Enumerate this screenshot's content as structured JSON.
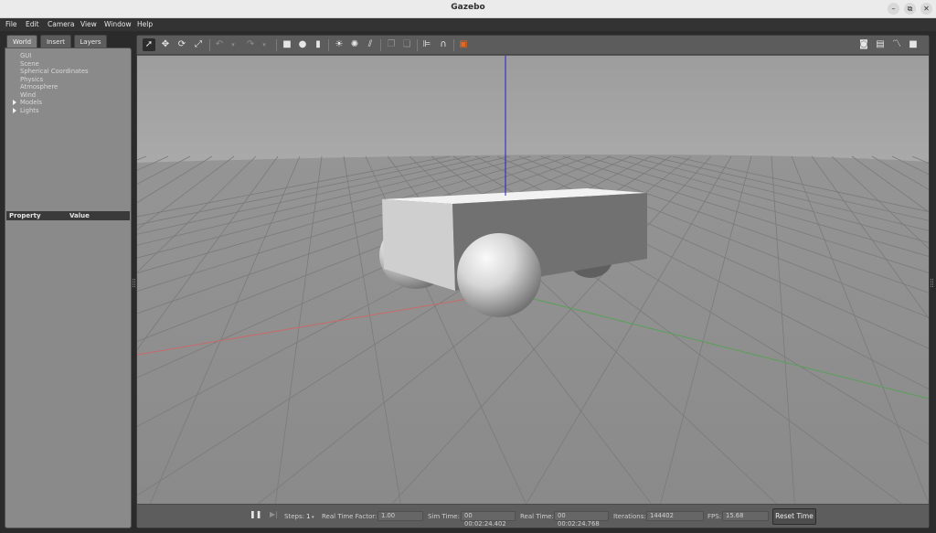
{
  "window": {
    "title": "Gazebo",
    "minimize_icon": "–",
    "maximize_icon": "⧉",
    "close_icon": "✕"
  },
  "menu": [
    "File",
    "Edit",
    "Camera",
    "View",
    "Window",
    "Help"
  ],
  "left_panel": {
    "tabs": [
      "World",
      "Insert",
      "Layers"
    ],
    "active_tab": "World",
    "tree": [
      {
        "label": "GUI",
        "expandable": false
      },
      {
        "label": "Scene",
        "expandable": false
      },
      {
        "label": "Spherical Coordinates",
        "expandable": false
      },
      {
        "label": "Physics",
        "expandable": false
      },
      {
        "label": "Atmosphere",
        "expandable": false
      },
      {
        "label": "Wind",
        "expandable": false
      },
      {
        "label": "Models",
        "expandable": true
      },
      {
        "label": "Lights",
        "expandable": true
      }
    ],
    "property_header": {
      "property": "Property",
      "value": "Value"
    }
  },
  "toolbar": {
    "tools": [
      {
        "name": "select-mode-icon",
        "glyph": "➚",
        "selected": true
      },
      {
        "name": "translate-mode-icon",
        "glyph": "✥"
      },
      {
        "name": "rotate-mode-icon",
        "glyph": "⟳"
      },
      {
        "name": "scale-mode-icon",
        "glyph": "⤢"
      },
      {
        "name": "undo-icon",
        "glyph": "↶",
        "dim": true
      },
      {
        "name": "undo-history-icon",
        "glyph": "▾",
        "dim": true
      },
      {
        "name": "redo-icon",
        "glyph": "↷",
        "dim": true
      },
      {
        "name": "redo-history-icon",
        "glyph": "▾",
        "dim": true
      },
      {
        "name": "box-shape-icon",
        "glyph": "■"
      },
      {
        "name": "sphere-shape-icon",
        "glyph": "●"
      },
      {
        "name": "cylinder-shape-icon",
        "glyph": "▮"
      },
      {
        "name": "point-light-icon",
        "glyph": "☀"
      },
      {
        "name": "spot-light-icon",
        "glyph": "✺"
      },
      {
        "name": "directional-light-icon",
        "glyph": "⫽"
      },
      {
        "name": "copy-icon",
        "glyph": "❐",
        "dim": true
      },
      {
        "name": "paste-icon",
        "glyph": "❏",
        "dim": true
      },
      {
        "name": "align-icon",
        "glyph": "⊫"
      },
      {
        "name": "snap-icon",
        "glyph": "∩"
      },
      {
        "name": "change-view-icon",
        "glyph": "▣",
        "accent": "#e8671c"
      }
    ],
    "right_tools": [
      {
        "name": "screenshot-icon",
        "glyph": "◙"
      },
      {
        "name": "log-icon",
        "glyph": "▤"
      },
      {
        "name": "plot-icon",
        "glyph": "〽"
      },
      {
        "name": "video-record-icon",
        "glyph": "■"
      }
    ]
  },
  "colors": {
    "x_axis": "#c86a6a",
    "y_axis": "#58a058",
    "z_axis": "#2020cc",
    "accent": "#e8671c"
  },
  "bottom_bar": {
    "pause_icon": "❚❚",
    "step_icon": "▶|",
    "steps_label": "Steps:",
    "steps_value": "1",
    "real_time_factor_label": "Real Time Factor:",
    "real_time_factor_value": "1.00",
    "sim_time_label": "Sim Time:",
    "sim_time_value": "00 00:02:24.402",
    "real_time_label": "Real Time:",
    "real_time_value": "00 00:02:24.768",
    "iterations_label": "Iterations:",
    "iterations_value": "144402",
    "fps_label": "FPS:",
    "fps_value": "15.68",
    "reset_time_label": "Reset Time"
  }
}
